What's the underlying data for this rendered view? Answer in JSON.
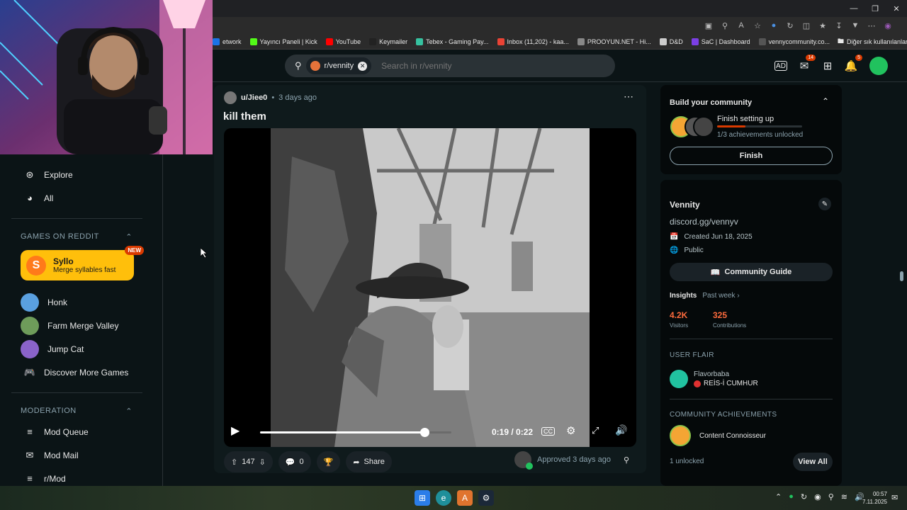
{
  "browser": {
    "bookmarks": [
      {
        "label": "etwork",
        "color": "#1a73e8"
      },
      {
        "label": "Yayıncı Paneli | Kick",
        "color": "#53fc18"
      },
      {
        "label": "YouTube",
        "color": "#ff0000"
      },
      {
        "label": "Keymailer",
        "color": "#222222"
      },
      {
        "label": "Tebex - Gaming Pay...",
        "color": "#36c2a0"
      },
      {
        "label": "Inbox (11,202) - kaa...",
        "color": "#ea4335"
      },
      {
        "label": "PROOYUN.NET - Hi...",
        "color": "#888888"
      },
      {
        "label": "D&D",
        "color": "#cccccc"
      },
      {
        "label": "SaC | Dashboard",
        "color": "#7b3fe4"
      },
      {
        "label": "vennycommunity.co...",
        "color": "#555555"
      }
    ],
    "other_bookmarks": "Diğer sık kullanılanlar"
  },
  "header": {
    "search_chip": "r/vennity",
    "search_placeholder": "Search in r/vennity",
    "chat_badge": "14",
    "notif_badge": "5"
  },
  "sidebar": {
    "nav": [
      {
        "label": "Explore",
        "icon": "explore-icon"
      },
      {
        "label": "All",
        "icon": "all-icon"
      }
    ],
    "games_heading": "GAMES ON REDDIT",
    "featured_game": {
      "title": "Syllo",
      "subtitle": "Merge syllables fast",
      "badge": "NEW"
    },
    "games": [
      {
        "label": "Honk"
      },
      {
        "label": "Farm Merge Valley"
      },
      {
        "label": "Jump Cat"
      },
      {
        "label": "Discover More Games"
      }
    ],
    "moderation_heading": "MODERATION",
    "moderation": [
      {
        "label": "Mod Queue"
      },
      {
        "label": "Mod Mail"
      },
      {
        "label": "r/Mod"
      }
    ]
  },
  "post": {
    "author": "u/Jiee0",
    "time": "3 days ago",
    "title": "kill them",
    "video": {
      "time_display": "0:19 / 0:22",
      "progress": 0.86
    },
    "votes": "147",
    "comments": "0",
    "share_label": "Share",
    "approved_label": "Approved 3 days ago"
  },
  "right": {
    "build": {
      "title": "Build your community",
      "subtitle": "Finish setting up",
      "progress_text": "1/3 achievements unlocked",
      "progress": 0.33,
      "button": "Finish"
    },
    "community": {
      "name": "Vennity",
      "link": "discord.gg/vennyv",
      "created": "Created Jun 18, 2025",
      "visibility": "Public",
      "guide_button": "Community Guide",
      "insights_label": "Insights",
      "insights_period": "Past week",
      "visitors_value": "4.2K",
      "visitors_label": "Visitors",
      "contrib_value": "325",
      "contrib_label": "Contributions",
      "flair_heading": "USER FLAIR",
      "flair_user": "Flavorbaba",
      "flair_tag": "REİS-İ CUMHUR",
      "achievements_heading": "COMMUNITY ACHIEVEMENTS",
      "achievement": "Content Connoisseur",
      "unlocked": "1 unlocked",
      "view_all": "View All"
    }
  },
  "taskbar": {
    "time": "00:57",
    "date": "7.11.2025"
  },
  "colors": {
    "accent_orange": "#d93a00",
    "page_bg": "#0b1416",
    "featured_bg": "#ffbf0b"
  }
}
